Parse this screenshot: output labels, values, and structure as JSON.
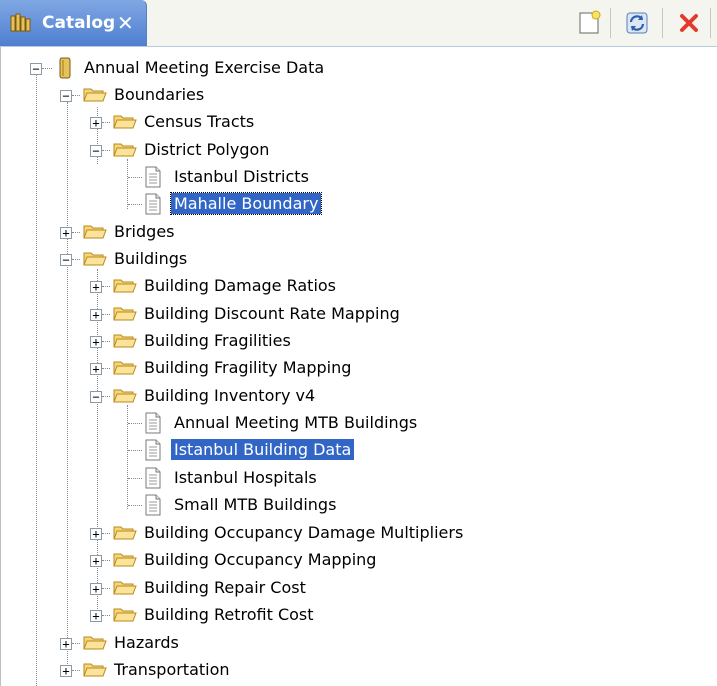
{
  "tab": {
    "title": "Catalog",
    "close": "✕"
  },
  "toolbar": {
    "new_icon": "new-document-icon",
    "refresh_icon": "refresh-icon",
    "delete_icon": "delete-icon"
  },
  "tree": {
    "root": "Annual Meeting Exercise Data",
    "boundaries": "Boundaries",
    "census_tracts": "Census Tracts",
    "district_polygon": "District Polygon",
    "istanbul_districts": "Istanbul Districts",
    "mahalle_boundary": "Mahalle Boundary",
    "bridges": "Bridges",
    "buildings": "Buildings",
    "building_damage_ratios": "Building Damage Ratios",
    "building_discount_rate_mapping": "Building Discount Rate Mapping",
    "building_fragilities": "Building Fragilities",
    "building_fragility_mapping": "Building Fragility Mapping",
    "building_inventory_v4": "Building Inventory v4",
    "annual_meeting_mtb_buildings": "Annual Meeting MTB Buildings",
    "istanbul_building_data": "Istanbul Building Data",
    "istanbul_hospitals": "Istanbul Hospitals",
    "small_mtb_buildings": "Small MTB Buildings",
    "building_occupancy_damage_multipliers": "Building Occupancy Damage Multipliers",
    "building_occupancy_mapping": "Building Occupancy Mapping",
    "building_repair_cost": "Building Repair Cost",
    "building_retrofit_cost": "Building Retrofit Cost",
    "hazards": "Hazards",
    "transportation": "Transportation"
  },
  "colors": {
    "tab_blue": "#4f7fd1",
    "selection": "#3166c6",
    "folder": "#f3c65a",
    "delete_red": "#e23b2e"
  }
}
